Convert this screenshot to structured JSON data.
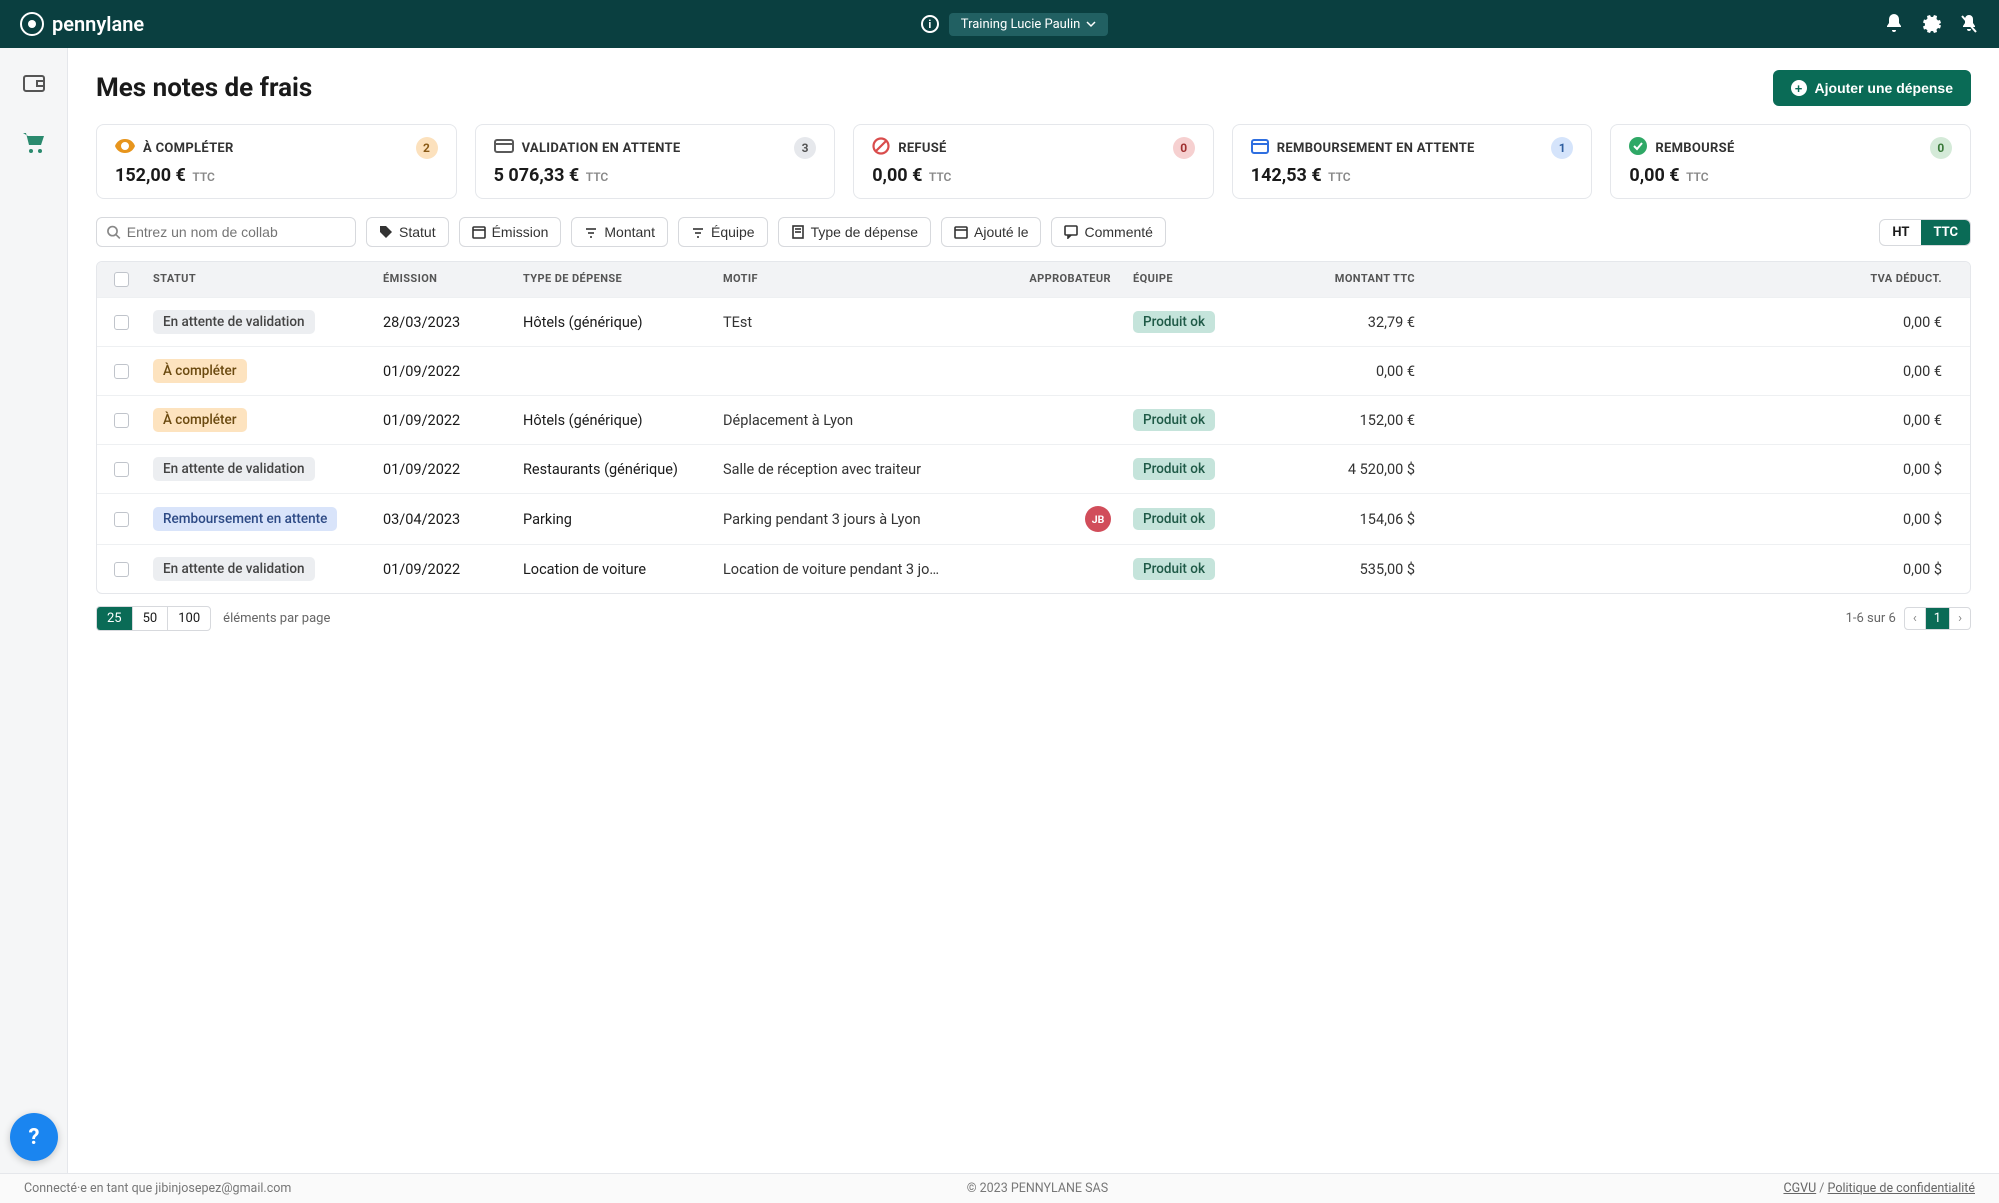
{
  "header": {
    "brand": "pennylane",
    "org": "Training Lucie Paulin"
  },
  "page": {
    "title": "Mes notes de frais",
    "add_button": "Ajouter une dépense"
  },
  "cards": [
    {
      "label": "À COMPLÉTER",
      "count": "2",
      "count_class": "badge-warn",
      "amount": "152,00 €",
      "ttc": "TTC",
      "icon": "eye"
    },
    {
      "label": "VALIDATION EN ATTENTE",
      "count": "3",
      "count_class": "badge-gray",
      "amount": "5 076,33 €",
      "ttc": "TTC",
      "icon": "card"
    },
    {
      "label": "REFUSÉ",
      "count": "0",
      "count_class": "badge-red",
      "amount": "0,00 €",
      "ttc": "TTC",
      "icon": "forbid"
    },
    {
      "label": "REMBOURSEMENT EN ATTENTE",
      "count": "1",
      "count_class": "badge-blue",
      "amount": "142,53 €",
      "ttc": "TTC",
      "icon": "calendar"
    },
    {
      "label": "REMBOURSÉ",
      "count": "0",
      "count_class": "badge-green",
      "amount": "0,00 €",
      "ttc": "TTC",
      "icon": "check"
    }
  ],
  "filters": {
    "search_placeholder": "Entrez un nom de collab",
    "statut": "Statut",
    "emission": "Émission",
    "montant": "Montant",
    "equipe": "Équipe",
    "type": "Type de dépense",
    "ajoute": "Ajouté le",
    "commente": "Commenté",
    "ht": "HT",
    "ttc": "TTC"
  },
  "columns": {
    "statut": "STATUT",
    "emission": "ÉMISSION",
    "type": "TYPE DE DÉPENSE",
    "motif": "MOTIF",
    "approbateur": "APPROBATEUR",
    "equipe": "ÉQUIPE",
    "montant": "MONTANT TTC",
    "tva": "TVA DÉDUCT."
  },
  "rows": [
    {
      "status": "En attente de validation",
      "status_class": "pill-gray",
      "emission": "28/03/2023",
      "type": "Hôtels (générique)",
      "motif": "TEst",
      "approver": "",
      "team": "Produit ok",
      "montant": "32,79 €",
      "tva": "0,00 €"
    },
    {
      "status": "À compléter",
      "status_class": "pill-orange",
      "emission": "01/09/2022",
      "type": "",
      "motif": "",
      "approver": "",
      "team": "",
      "montant": "0,00 €",
      "tva": "0,00 €"
    },
    {
      "status": "À compléter",
      "status_class": "pill-orange",
      "emission": "01/09/2022",
      "type": "Hôtels (générique)",
      "motif": "Déplacement à Lyon",
      "approver": "",
      "team": "Produit ok",
      "montant": "152,00 €",
      "tva": "0,00 €"
    },
    {
      "status": "En attente de validation",
      "status_class": "pill-gray",
      "emission": "01/09/2022",
      "type": "Restaurants (générique)",
      "motif": "Salle de réception avec traiteur",
      "approver": "",
      "team": "Produit ok",
      "montant": "4 520,00 $",
      "tva": "0,00 $"
    },
    {
      "status": "Remboursement en attente",
      "status_class": "pill-blue",
      "emission": "03/04/2023",
      "type": "Parking",
      "motif": "Parking pendant 3 jours à Lyon",
      "approver": "JB",
      "team": "Produit ok",
      "montant": "154,06 $",
      "tva": "0,00 $"
    },
    {
      "status": "En attente de validation",
      "status_class": "pill-gray",
      "emission": "01/09/2022",
      "type": "Location de voiture",
      "motif": "Location de voiture pendant 3 jo…",
      "approver": "",
      "team": "Produit ok",
      "montant": "535,00 $",
      "tva": "0,00 $"
    }
  ],
  "pagination": {
    "sizes": [
      "25",
      "50",
      "100"
    ],
    "label": "éléments par page",
    "range": "1-6 sur 6",
    "pages": [
      "1"
    ]
  },
  "footer": {
    "left": "Connecté·e en tant que jibinjosepez@gmail.com",
    "mid": "© 2023 PENNYLANE SAS",
    "cgvu": "CGVU",
    "sep": " / ",
    "privacy": "Politique de confidentialité"
  }
}
